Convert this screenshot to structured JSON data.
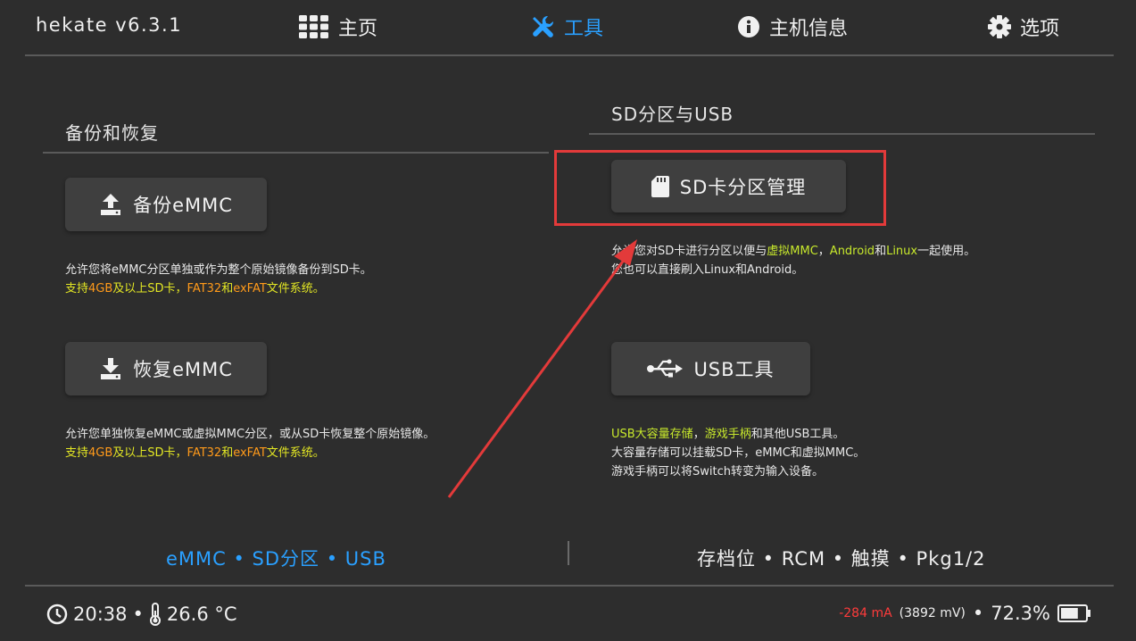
{
  "header": {
    "app_title": "hekate v6.3.1",
    "nav": [
      {
        "label": "主页",
        "icon": "grid-icon",
        "active": false
      },
      {
        "label": "工具",
        "icon": "tools-icon",
        "active": true
      },
      {
        "label": "主机信息",
        "icon": "info-icon",
        "active": false
      },
      {
        "label": "选项",
        "icon": "gear-icon",
        "active": false
      }
    ]
  },
  "left": {
    "title": "备份和恢复",
    "backup": {
      "label": "备份eMMC",
      "icon": "upload-icon",
      "desc1": "允许您将eMMC分区单独或作为整个原始镜像备份到SD卡。",
      "desc2": {
        "a": "支持",
        "b": "4GB",
        "c": "及以上SD卡，",
        "d": "FAT32",
        "e": "和",
        "f": "exFAT",
        "g": "文件系统。"
      }
    },
    "restore": {
      "label": "恢复eMMC",
      "icon": "download-icon",
      "desc1": "允许您单独恢复eMMC或虚拟MMC分区，或从SD卡恢复整个原始镜像。",
      "desc2": {
        "a": "支持",
        "b": "4GB",
        "c": "及以上SD卡，",
        "d": "FAT32",
        "e": "和",
        "f": "exFAT",
        "g": "文件系统。"
      }
    }
  },
  "right": {
    "title": "SD分区与USB",
    "sd": {
      "label": "SD卡分区管理",
      "icon": "sd-card-icon",
      "desc1": {
        "a": "允许您对SD卡进行分区以便与",
        "b": "虚拟MMC",
        "c": "，",
        "d": "Android",
        "e": "和",
        "f": "Linux",
        "g": "一起使用。"
      },
      "desc2": "您也可以直接刷入Linux和Android。"
    },
    "usb": {
      "label": "USB工具",
      "icon": "usb-icon",
      "desc1": {
        "a": "USB大容量存储",
        "b": "，",
        "c": "游戏手柄",
        "d": "和其他USB工具。"
      },
      "desc2": "大容量存储可以挂载SD卡，eMMC和虚拟MMC。",
      "desc3": "游戏手柄可以将Switch转变为输入设备。"
    }
  },
  "footer": {
    "left": "eMMC • SD分区 • USB",
    "right": "存档位 • RCM • 触摸 • Pkg1/2"
  },
  "status": {
    "time": "20:38",
    "sep": "•",
    "temperature": "26.6 °C",
    "current": "-284 mA",
    "voltage": "(3892 mV)",
    "battery": "72.3%",
    "battery_level": 0.723
  },
  "colors": {
    "accent": "#2aa0ff",
    "highlight_box": "#e33a3a",
    "arrow": "#e33a3a"
  }
}
